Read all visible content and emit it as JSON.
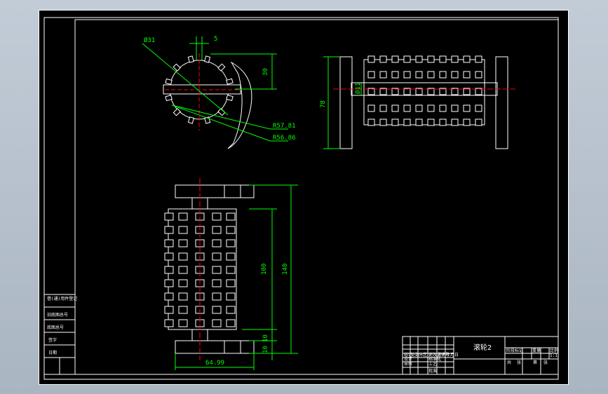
{
  "window": {
    "background": "#b9c3cf",
    "canvas_color": "#000000"
  },
  "colors": {
    "outline": "#ffffff",
    "dimension": "#00ff00",
    "centerline": "#ff0000"
  },
  "drawing": {
    "title": "滚轮2",
    "top_view": {
      "dims": {
        "dia_inner": "Ø31",
        "slot": "5",
        "height": "30",
        "r_outer": "R57.81",
        "r_inner": "R56.86"
      }
    },
    "side_view": {
      "dims": {
        "height": "78",
        "shaft_dia": "Ø11"
      }
    },
    "front_view": {
      "dims": {
        "body_len": "100",
        "total_len": "140",
        "end1": "10",
        "end2": "10",
        "width": "64.99"
      }
    },
    "left_table": {
      "rows": [
        "借(通)用件登记",
        "旧底图总号",
        "底图总号",
        "签字",
        "日期"
      ]
    },
    "title_block": {
      "cells": [
        "标记",
        "处数",
        "分区",
        "更改文件号",
        "签名",
        "年月日",
        "设计",
        "标准化",
        "阶段标记",
        "重量",
        "比例",
        "审核",
        "工艺",
        "批准",
        "共",
        "张",
        "第",
        "张",
        "1:1"
      ]
    }
  }
}
